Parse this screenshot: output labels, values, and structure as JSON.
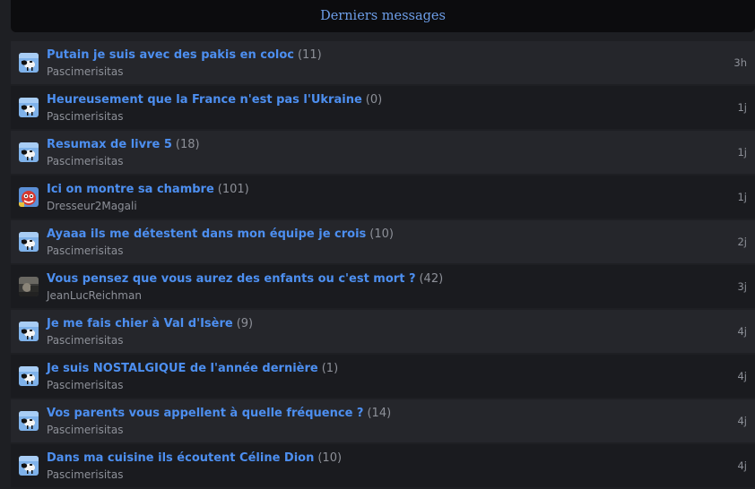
{
  "header": {
    "title": "Derniers messages"
  },
  "topics": [
    {
      "title": "Putain je suis avec des pakis en coloc",
      "count": "(11)",
      "author": "Pascimerisitas",
      "time": "3h",
      "avatar": "avatar-sheep"
    },
    {
      "title": "Heureusement que la France n'est pas l'Ukraine",
      "count": "(0)",
      "author": "Pascimerisitas",
      "time": "1j",
      "avatar": "avatar-sheep"
    },
    {
      "title": "Resumax de livre 5",
      "count": "(18)",
      "author": "Pascimerisitas",
      "time": "1j",
      "avatar": "avatar-sheep"
    },
    {
      "title": "Ici on montre sa chambre",
      "count": "(101)",
      "author": "Dresseur2Magali",
      "time": "1j",
      "avatar": "avatar-cartoon"
    },
    {
      "title": "Ayaaa ils me détestent dans mon équipe je crois",
      "count": "(10)",
      "author": "Pascimerisitas",
      "time": "2j",
      "avatar": "avatar-sheep"
    },
    {
      "title": "Vous pensez que vous aurez des enfants ou c'est mort ?",
      "count": "(42)",
      "author": "JeanLucReichman",
      "time": "3j",
      "avatar": "avatar-photo"
    },
    {
      "title": "Je me fais chier à Val d'Isère",
      "count": "(9)",
      "author": "Pascimerisitas",
      "time": "4j",
      "avatar": "avatar-sheep"
    },
    {
      "title": "Je suis NOSTALGIQUE de l'année dernière",
      "count": "(1)",
      "author": "Pascimerisitas",
      "time": "4j",
      "avatar": "avatar-sheep"
    },
    {
      "title": "Vos parents vous appellent à quelle fréquence ?",
      "count": "(14)",
      "author": "Pascimerisitas",
      "time": "4j",
      "avatar": "avatar-sheep"
    },
    {
      "title": "Dans ma cuisine ils écoutent Céline Dion",
      "count": "(10)",
      "author": "Pascimerisitas",
      "time": "4j",
      "avatar": "avatar-sheep"
    }
  ]
}
